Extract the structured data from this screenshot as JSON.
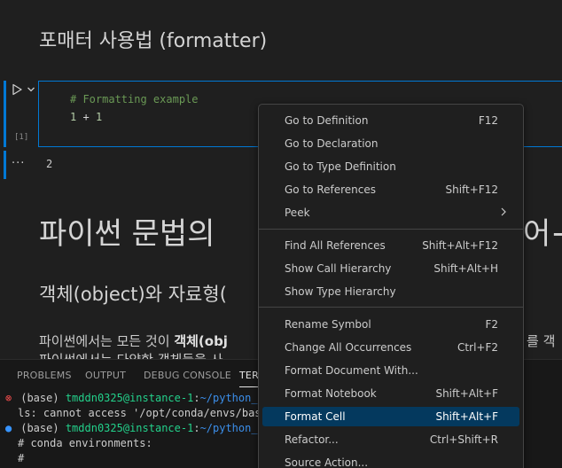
{
  "notebook": {
    "heading_formatter": "포매터 사용법 (formatter)",
    "code_cell": {
      "execution_count": "[1]",
      "lines": [
        "# Formatting example",
        "1",
        "+",
        "1"
      ]
    },
    "output_more": "···",
    "output_value": "2",
    "heading_python_syntax": "파이썬 문법의",
    "heading_python_syntax_tail": "어+",
    "heading_object": "객체(object)와 자료형(",
    "para1_start": "파이썬에서는 모든 것이 ",
    "para1_bold": "객체(obj",
    "para1_tail": "를 객",
    "para2": "파이썬에서는 다양한 객체들을 사"
  },
  "panel": {
    "tabs": [
      "PROBLEMS",
      "OUTPUT",
      "DEBUG CONSOLE",
      "TER"
    ],
    "active_tab": "TER",
    "terminal": {
      "line1": {
        "status": "⊗",
        "env": "(base)",
        "user": "tmddn0325@instance-1",
        "sep": ":",
        "path": "~/python_le"
      },
      "line2": "ls: cannot access '/opt/conda/envs/basi",
      "line3": {
        "status": "●",
        "env": "(base)",
        "user": "tmddn0325@instance-1",
        "sep": ":",
        "path": "~/python_le"
      },
      "line4": "# conda environments:",
      "line5": "#"
    }
  },
  "context_menu": {
    "items": [
      {
        "label": "Go to Definition",
        "shortcut": "F12"
      },
      {
        "label": "Go to Declaration",
        "shortcut": ""
      },
      {
        "label": "Go to Type Definition",
        "shortcut": ""
      },
      {
        "label": "Go to References",
        "shortcut": "Shift+F12"
      },
      {
        "label": "Peek",
        "shortcut": ""
      },
      {
        "label": "Find All References",
        "shortcut": "Shift+Alt+F12"
      },
      {
        "label": "Show Call Hierarchy",
        "shortcut": "Shift+Alt+H"
      },
      {
        "label": "Show Type Hierarchy",
        "shortcut": ""
      },
      {
        "label": "Rename Symbol",
        "shortcut": "F2"
      },
      {
        "label": "Change All Occurrences",
        "shortcut": "Ctrl+F2"
      },
      {
        "label": "Format Document With...",
        "shortcut": ""
      },
      {
        "label": "Format Notebook",
        "shortcut": "Shift+Alt+F"
      },
      {
        "label": "Format Cell",
        "shortcut": "Shift+Alt+F"
      },
      {
        "label": "Refactor...",
        "shortcut": "Ctrl+Shift+R"
      },
      {
        "label": "Source Action...",
        "shortcut": ""
      }
    ],
    "selected_item": "Format Cell"
  },
  "colors": {
    "accent": "#0078d4",
    "selection": "#04395e",
    "comment": "#6a9955",
    "terminal_user": "#23d18b",
    "terminal_path": "#3b8eea",
    "error": "#f14c4c"
  }
}
